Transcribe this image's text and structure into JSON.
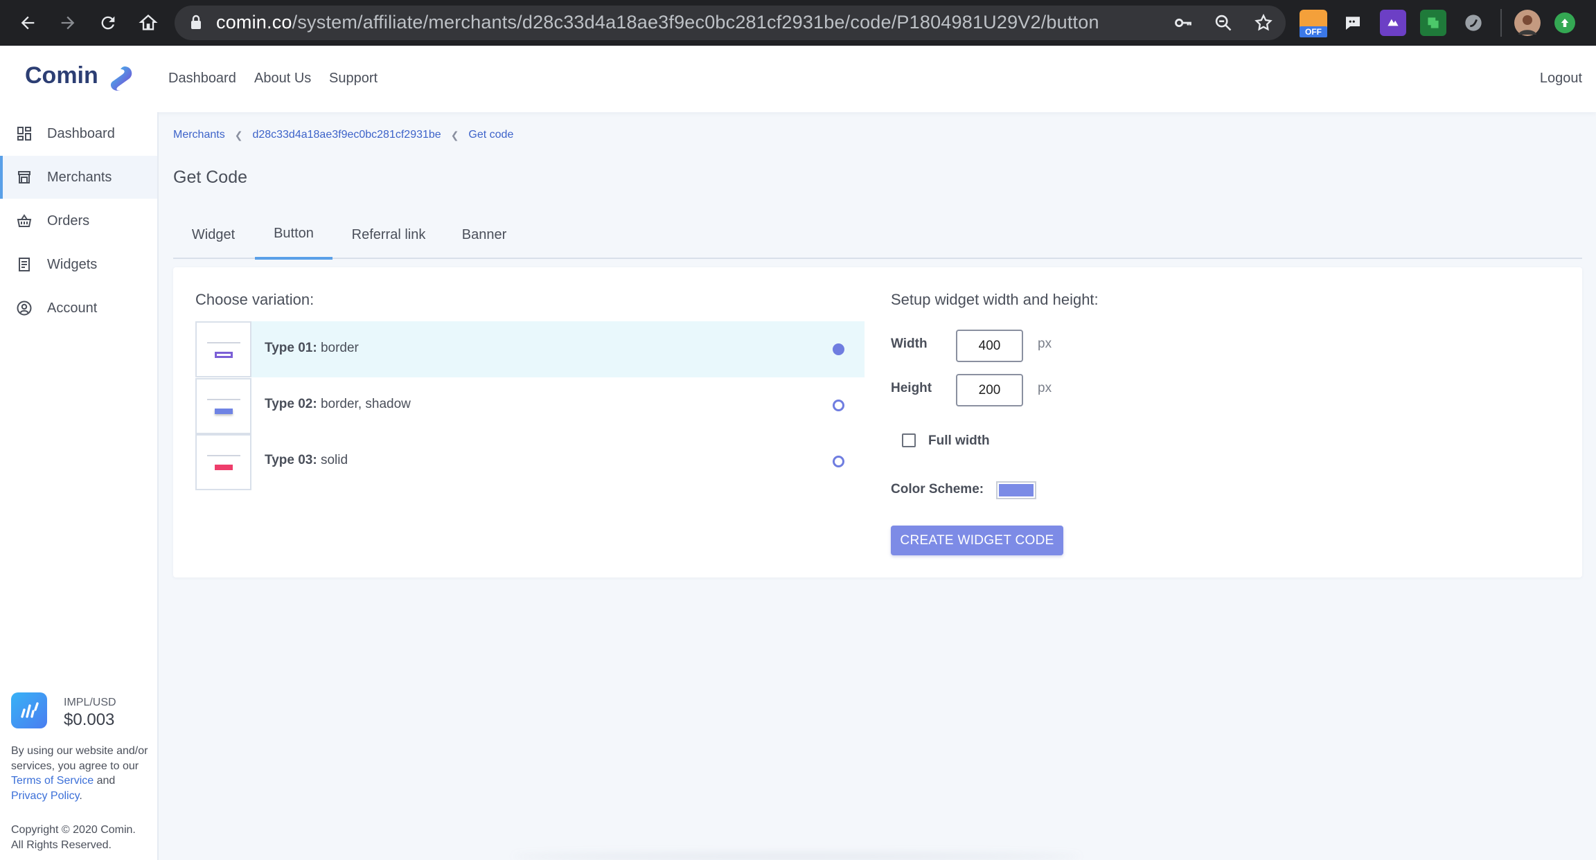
{
  "browser": {
    "url_host": "comin.co",
    "url_path": "/system/affiliate/merchants/d28c33d4a18ae3f9ec0bc281cf2931be/code/P1804981U29V2/button",
    "extension_badge": "OFF"
  },
  "header": {
    "logo": "Comin",
    "nav": [
      "Dashboard",
      "About Us",
      "Support"
    ],
    "logout": "Logout"
  },
  "sidebar": {
    "items": [
      {
        "label": "Dashboard",
        "icon": "dashboard-grid-icon"
      },
      {
        "label": "Merchants",
        "icon": "store-icon",
        "active": true
      },
      {
        "label": "Orders",
        "icon": "basket-icon"
      },
      {
        "label": "Widgets",
        "icon": "widget-icon"
      },
      {
        "label": "Account",
        "icon": "user-circle-icon"
      }
    ],
    "ticker": {
      "pair": "IMPL/USD",
      "price": "$0.003"
    },
    "legal": {
      "prefix": "By using our website and/or services, you agree to our ",
      "terms": "Terms of Service",
      "and": " and ",
      "privacy": "Privacy Policy",
      "suffix": "."
    },
    "copyright": "Copyright © 2020 Comin. All Rights Reserved."
  },
  "breadcrumb": [
    "Merchants",
    "d28c33d4a18ae3f9ec0bc281cf2931be",
    "Get code"
  ],
  "page_title": "Get Code",
  "tabs": [
    {
      "label": "Widget"
    },
    {
      "label": "Button",
      "active": true
    },
    {
      "label": "Referral link"
    },
    {
      "label": "Banner"
    }
  ],
  "variations": {
    "heading": "Choose variation:",
    "items": [
      {
        "name": "Type 01:",
        "desc": " border",
        "selected": true,
        "accent": "#7b5fd6"
      },
      {
        "name": "Type 02:",
        "desc": " border, shadow",
        "selected": false,
        "accent": "#6f83e4"
      },
      {
        "name": "Type 03:",
        "desc": " solid",
        "selected": false,
        "accent": "#ee3d6b"
      }
    ]
  },
  "setup": {
    "heading": "Setup widget width and height:",
    "width_label": "Width",
    "width_value": "400",
    "height_label": "Height",
    "height_value": "200",
    "unit": "px",
    "full_width_label": "Full width",
    "full_width_checked": false,
    "color_scheme_label": "Color Scheme:",
    "color_scheme_value": "#7b8be6",
    "create_button": "CREATE WIDGET CODE"
  },
  "colors": {
    "accent": "#5aa0e8",
    "button": "#7d8be6",
    "link": "#3d63c9"
  }
}
